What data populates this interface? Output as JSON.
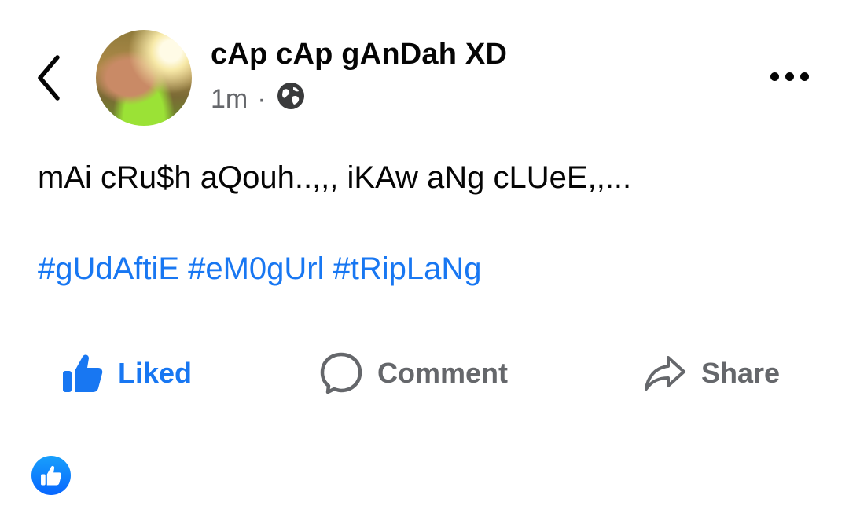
{
  "header": {
    "author_name": "cAp cAp gAnDah XD",
    "timestamp": "1m",
    "separator": "·",
    "privacy_icon": "globe-icon"
  },
  "post": {
    "text": "mAi cRu$h aQouh..,,, iKAw aNg cLUeE,,...",
    "hashtags": [
      "#gUdAftiE",
      "#eM0gUrl",
      "#tRipLaNg"
    ]
  },
  "actions": {
    "like_label": "Liked",
    "comment_label": "Comment",
    "share_label": "Share"
  },
  "colors": {
    "accent": "#1877f2",
    "secondary_text": "#65676b",
    "primary_text": "#050505"
  }
}
